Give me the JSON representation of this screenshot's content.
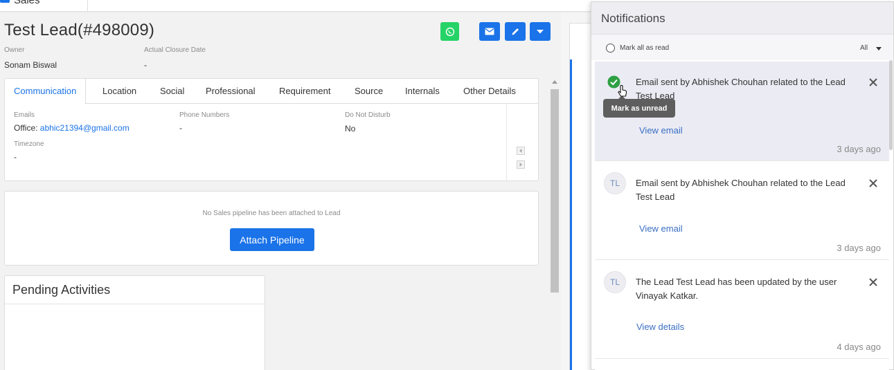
{
  "topbar": {
    "app_name": "Sales"
  },
  "lead": {
    "title": "Test Lead(#498009)",
    "owner_label": "Owner",
    "owner_value": "Sonam Biswal",
    "closure_label": "Actual Closure Date",
    "closure_value": "-"
  },
  "tabs": [
    "Communication",
    "Location",
    "Social",
    "Professional",
    "Requirement",
    "Source",
    "Internals",
    "Other Details"
  ],
  "communication": {
    "emails_label": "Emails",
    "emails_prefix": "Office: ",
    "emails_value": "abhic21394@gmail.com",
    "phone_label": "Phone Numbers",
    "phone_value": "-",
    "dnd_label": "Do Not Disturb",
    "dnd_value": "No",
    "timezone_label": "Timezone",
    "timezone_value": "-"
  },
  "pipeline": {
    "empty_text": "No Sales pipeline has been attached to Lead",
    "attach_label": "Attach Pipeline"
  },
  "pending": {
    "title": "Pending Activities"
  },
  "notifications": {
    "title": "Notifications",
    "mark_all": "Mark all as read",
    "filter": "All",
    "items": [
      {
        "avatar": "",
        "message": "Email sent by Abhishek Chouhan related to the Lead Test Lead",
        "link": "View email",
        "time": "3 days ago",
        "tooltip": "Mark as unread"
      },
      {
        "avatar": "TL",
        "message": "Email sent by Abhishek Chouhan related to the Lead Test Lead",
        "link": "View email",
        "time": "3 days ago"
      },
      {
        "avatar": "TL",
        "message": "The Lead Test Lead has been updated by the user Vinayak Katkar.",
        "link": "View details",
        "time": "4 days ago"
      }
    ]
  },
  "colors": {
    "primary": "#1a73e8",
    "whatsapp": "#25d366",
    "success": "#2ea043"
  }
}
